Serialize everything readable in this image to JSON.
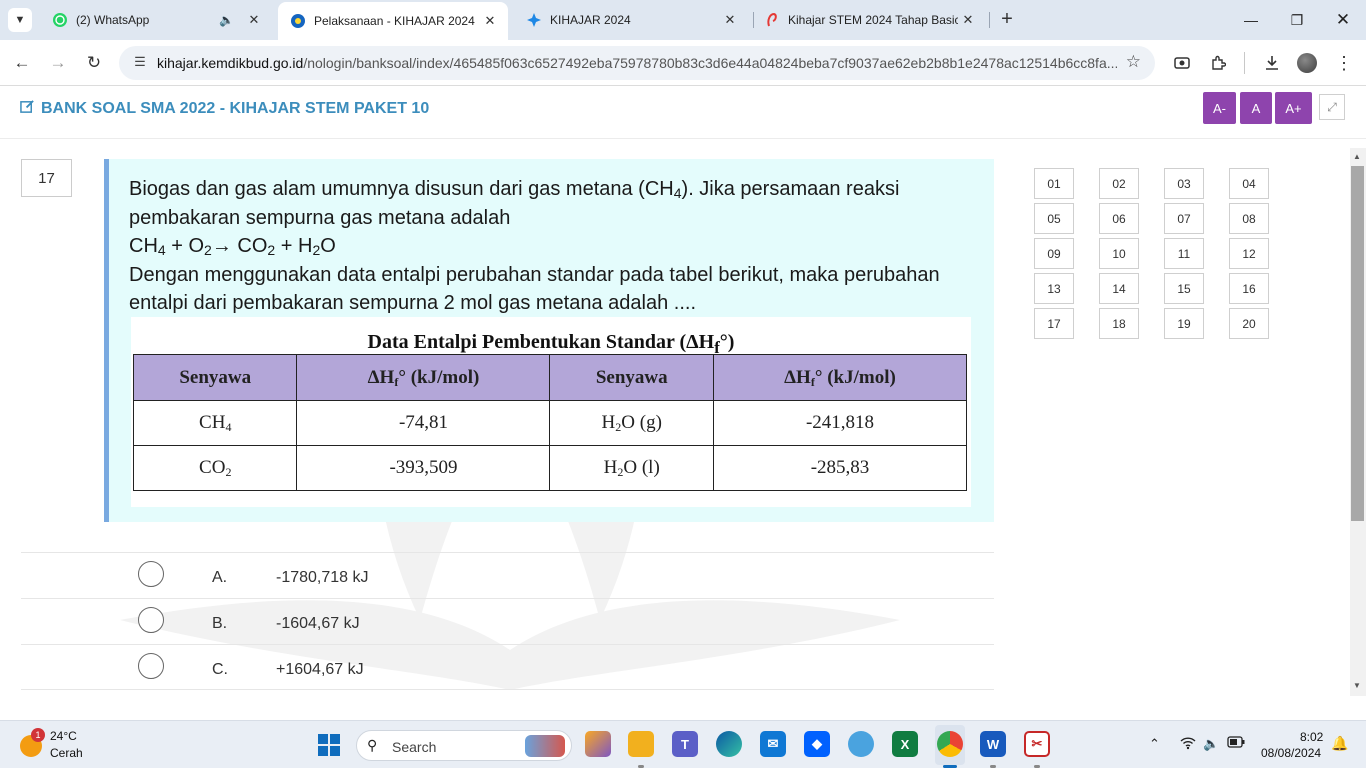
{
  "browser": {
    "tabs": [
      {
        "title": "(2) WhatsApp",
        "favicon": "whatsapp-icon",
        "audio": true
      },
      {
        "title": "Pelaksanaan - KIHAJAR 2024",
        "favicon": "kemdikbud-icon",
        "active": true
      },
      {
        "title": "KIHAJAR 2024",
        "favicon": "kihajar-icon"
      },
      {
        "title": "Kihajar STEM 2024 Tahap Basic",
        "favicon": "kihajar-stem-icon"
      }
    ],
    "url_host": "kihajar.kemdikbud.go.id",
    "url_path": "/nologin/banksoal/index/465485f063c6527492eba75978780b83c3d6e44a04824beba7cf9037ae62eb2b8b1e2478ac12514b6cc8fa..."
  },
  "header": {
    "title": "BANK SOAL SMA 2022 - KIHAJAR STEM PAKET 10",
    "font_small": "A-",
    "font_normal": "A",
    "font_large": "A+"
  },
  "question": {
    "number": "17",
    "text_1": "Biogas dan gas alam umumnya disusun dari gas metana (CH",
    "text_1_sub": "4",
    "text_1_end": "). Jika persamaan reaksi pembakaran sempurna gas metana adalah",
    "eq": {
      "t1": "CH",
      "s1": "4",
      "t2": " + O",
      "s2": "2",
      "t3": "→ CO",
      "s3": "2",
      "t4": " + H",
      "s4": "2",
      "t5": "O"
    },
    "text_2": "Dengan menggunakan data entalpi perubahan standar pada tabel berikut, maka perubahan entalpi dari pembakaran sempurna 2 mol gas metana adalah ....",
    "table": {
      "caption": "Data Entalpi Pembentukan Standar (ΔH",
      "caption_sub": "f",
      "caption_end": "°)",
      "col_senyawa": "Senyawa",
      "col_dh": "ΔH",
      "col_dh_sub": "f",
      "col_dh_end": "° (kJ/mol)",
      "r1": {
        "c1": "CH",
        "c1s": "4",
        "c2": "-74,81",
        "c3": "H",
        "c3s": "2",
        "c3e": "O (g)",
        "c4": "-241,818"
      },
      "r2": {
        "c1": "CO",
        "c1s": "2",
        "c2": "-393,509",
        "c3": "H",
        "c3s": "2",
        "c3e": "O (l)",
        "c4": "-285,83"
      }
    }
  },
  "options": [
    {
      "letter": "A.",
      "text": "-1780,718 kJ"
    },
    {
      "letter": "B.",
      "text": "-1604,67 kJ"
    },
    {
      "letter": "C.",
      "text": "+1604,67 kJ"
    }
  ],
  "question_nav": [
    "01",
    "02",
    "03",
    "04",
    "05",
    "06",
    "07",
    "08",
    "09",
    "10",
    "11",
    "12",
    "13",
    "14",
    "15",
    "16",
    "17",
    "18",
    "19",
    "20"
  ],
  "taskbar": {
    "weather_badge": "1",
    "temperature": "24°C",
    "weather": "Cerah",
    "search_placeholder": "Search",
    "time": "8:02",
    "date": "08/08/2024"
  }
}
